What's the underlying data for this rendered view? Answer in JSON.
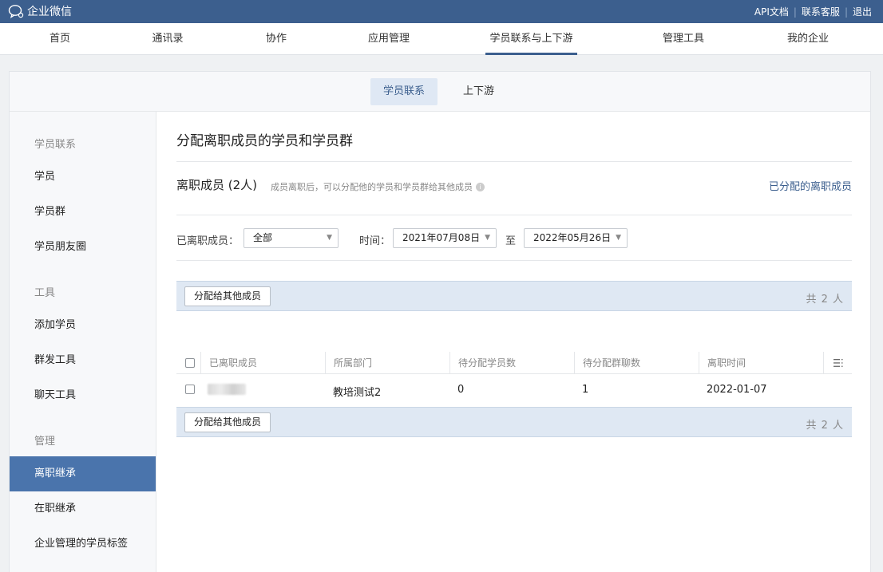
{
  "topbar": {
    "brand": "企业微信",
    "links": [
      "API文档",
      "联系客服",
      "退出"
    ]
  },
  "nav": {
    "items": [
      "首页",
      "通讯录",
      "协作",
      "应用管理",
      "学员联系与上下游",
      "管理工具",
      "我的企业"
    ],
    "active": "学员联系与上下游"
  },
  "subtabs": {
    "items": [
      "学员联系",
      "上下游"
    ],
    "active": "学员联系"
  },
  "sidebar": {
    "group_contact": "学员联系",
    "items_contact": [
      "学员",
      "学员群",
      "学员朋友圈"
    ],
    "group_tools": "工具",
    "items_tools": [
      "添加学员",
      "群发工具",
      "聊天工具"
    ],
    "group_manage": "管理",
    "items_manage": [
      "离职继承",
      "在职继承",
      "企业管理的学员标签"
    ],
    "active": "离职继承"
  },
  "main": {
    "page_title": "分配离职成员的学员和学员群",
    "section_title": "离职成员 (2人)",
    "section_desc": "成员离职后，可以分配他的学员和学员群给其他成员",
    "assigned_link": "已分配的离职成员",
    "filters": {
      "member_label": "已离职成员：",
      "member_value": "全部",
      "time_label": "时间：",
      "date_from": "2021年07月08日",
      "to_label": "至",
      "date_to": "2022年05月26日"
    },
    "assign_button": "分配给其他成员",
    "total_text": "共 2 人",
    "table": {
      "headers": [
        "已离职成员",
        "所属部门",
        "待分配学员数",
        "待分配群聊数",
        "离职时间"
      ],
      "rows": [
        {
          "member": "",
          "department": "教培测试2",
          "pending_students": "0",
          "pending_groups": "1",
          "leave_date": "2022-01-07"
        }
      ]
    }
  }
}
